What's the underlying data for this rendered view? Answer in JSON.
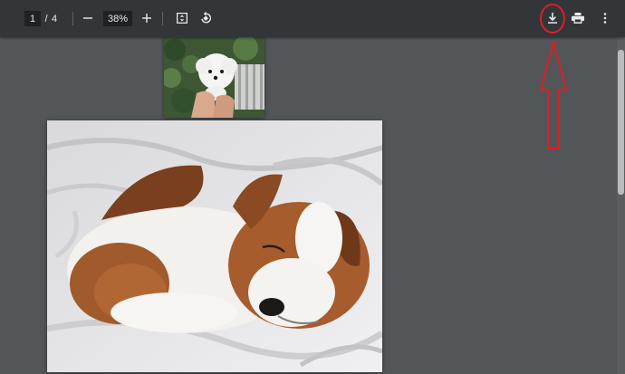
{
  "toolbar": {
    "current_page": "1",
    "page_separator": "/",
    "total_pages": "4",
    "zoom_level": "38%",
    "icons": {
      "zoom_out": "minus-icon",
      "zoom_in": "plus-icon",
      "fit": "fit-to-page-icon",
      "rotate": "rotate-icon",
      "download": "download-icon",
      "print": "print-icon",
      "more": "more-vert-icon"
    }
  },
  "document": {
    "pages": [
      {
        "content": "puppy-held-in-hand-photo"
      },
      {
        "content": "sleeping-puppy-photo"
      }
    ]
  },
  "annotation": {
    "color": "#e01d26"
  },
  "colors": {
    "toolbar_bg": "#323639",
    "viewer_bg": "#525659",
    "annotation": "#e01d26"
  }
}
